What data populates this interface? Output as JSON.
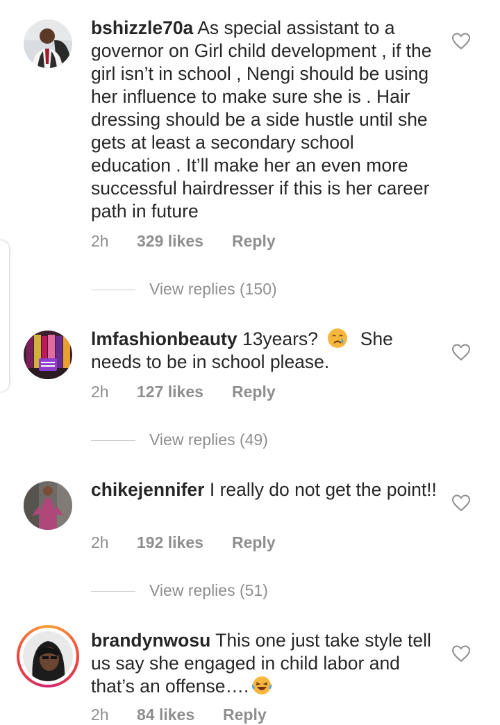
{
  "comments": [
    {
      "username": "bshizzle70a",
      "text": "As special assistant to a governor on Girl child development , if the girl isn’t in school , Nengi should be using her influence to make sure she is . Hair dressing should be a side hustle until she gets at least a secondary school education . It’ll make her an even more successful hairdresser if this is her career path in future",
      "time": "2h",
      "likes": "329 likes",
      "reply": "Reply",
      "view_replies": "View replies (150)"
    },
    {
      "username": "lmfashionbeauty",
      "text_before": "13years?",
      "text_after": "She needs to be in school please.",
      "emoji": "crying-face",
      "time": "2h",
      "likes": "127 likes",
      "reply": "Reply",
      "view_replies": "View replies (49)"
    },
    {
      "username": "chikejennifer",
      "text": "I really do not get the point!!",
      "time": "2h",
      "likes": "192 likes",
      "reply": "Reply",
      "view_replies": "View replies (51)"
    },
    {
      "username": "brandynwosu",
      "text": "This one just take style tell us say she engaged in child labor and that’s an offense….",
      "emoji": "laughing-tears",
      "time": "2h",
      "likes": "84 likes",
      "reply": "Reply"
    }
  ],
  "colors": {
    "text": "#262626",
    "secondary": "#8e8e8e",
    "story_ring": "#d1286c"
  }
}
